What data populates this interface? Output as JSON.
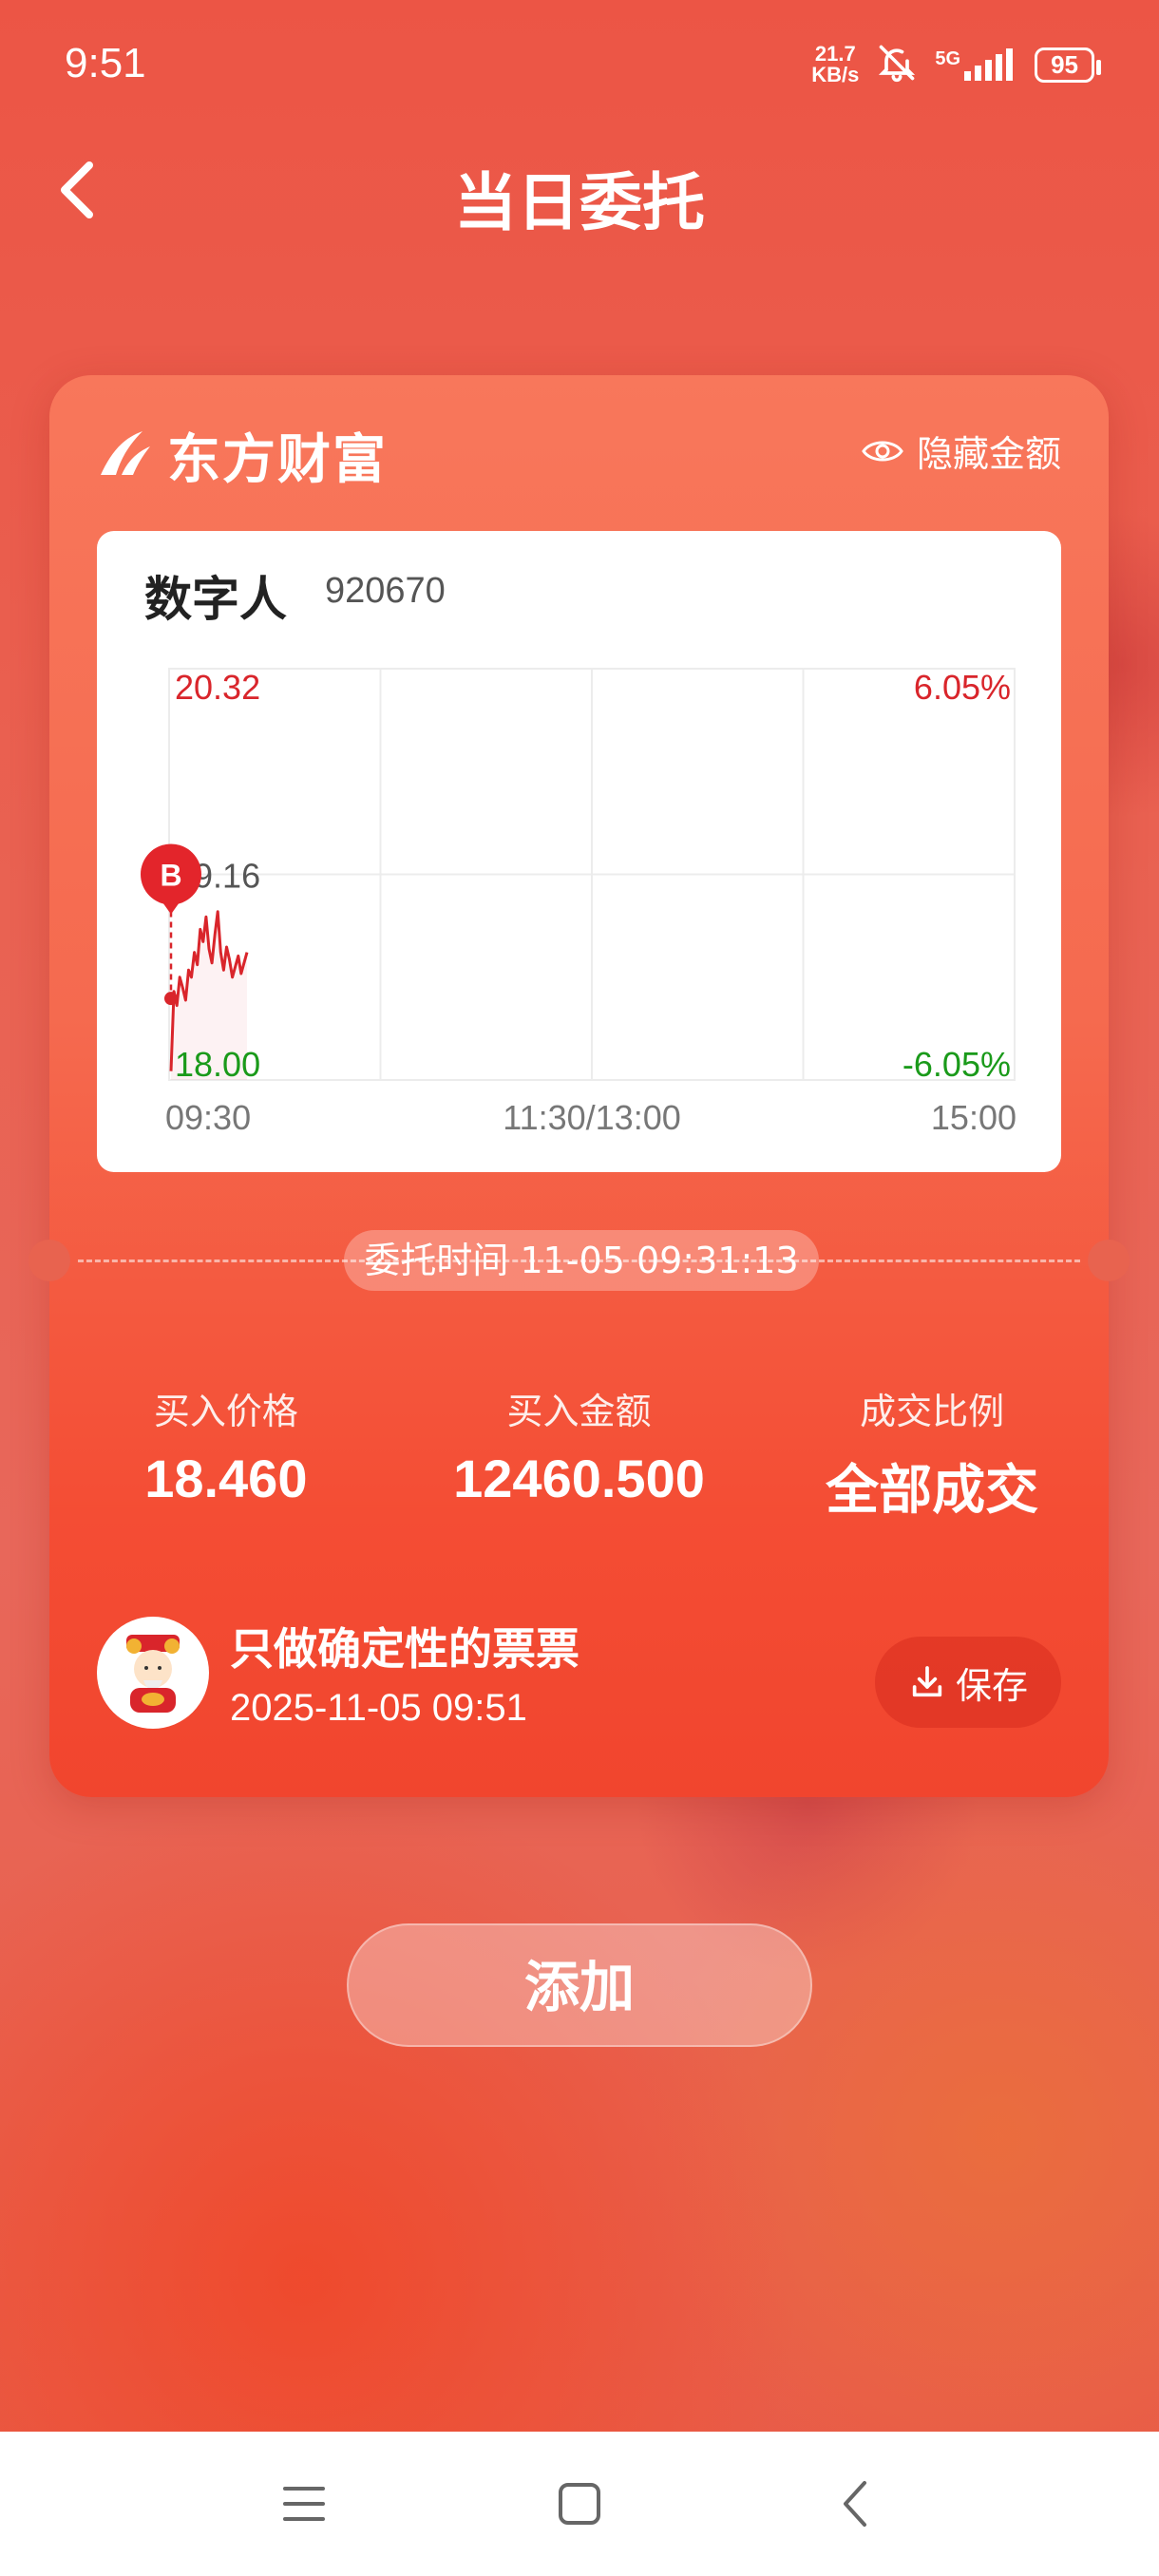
{
  "status_bar": {
    "time": "9:51",
    "net_speed_value": "21.7",
    "net_speed_unit": "KB/s",
    "network": "5G",
    "battery": "95",
    "icons": [
      "bell-off-icon",
      "signal-icon",
      "battery-icon"
    ]
  },
  "header": {
    "title": "当日委托",
    "back_icon": "chevron-left-icon"
  },
  "card": {
    "brand_name": "东方财富",
    "hide_amount_label": "隐藏金额",
    "stock": {
      "name": "数字人",
      "code": "920670"
    },
    "order_time_label": "委托时间 11-05 09:31:13",
    "stats": [
      {
        "label": "买入价格",
        "value": "18.460"
      },
      {
        "label": "买入金额",
        "value": "12460.500"
      },
      {
        "label": "成交比例",
        "value": "全部成交"
      }
    ],
    "author": {
      "name": "只做确定性的票票",
      "time": "2025-11-05 09:51"
    },
    "save_label": "保存"
  },
  "chart_data": {
    "type": "line",
    "price_max_label": "20.32",
    "price_mid_label": "19.16",
    "price_min_label": "18.00",
    "pct_max_label": "6.05%",
    "pct_min_label": "-6.05%",
    "x_tick_labels": [
      "09:30",
      "11:30/13:00",
      "15:00"
    ],
    "ylim": [
      18.0,
      20.32
    ],
    "buy_marker": "B",
    "buy_price": 18.46,
    "colors": {
      "line": "#d9252b",
      "up": "#d9252b",
      "down": "#1a9a1a",
      "grid": "#ececec"
    },
    "series": [
      {
        "values": [
          18.05,
          18.5,
          18.42,
          18.58,
          18.52,
          18.45,
          18.62,
          18.58,
          18.72,
          18.65,
          18.85,
          18.78,
          18.92,
          18.74,
          18.66,
          18.82,
          18.95,
          18.72,
          18.62,
          18.75,
          18.68,
          18.58,
          18.64,
          18.7,
          18.6,
          18.66,
          18.72
        ]
      }
    ]
  },
  "add_button_label": "添加",
  "nav_bar": {
    "icons": [
      "menu-icon",
      "home-square-icon",
      "back-triangle-icon"
    ]
  }
}
